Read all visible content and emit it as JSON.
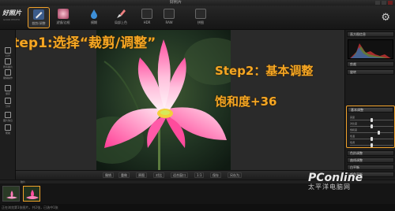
{
  "window": {
    "title": "好照片"
  },
  "toolbar": {
    "logo": "好照片",
    "logo_sub": "GOOD PHOTO",
    "tools": [
      {
        "label": "裁剪/调整",
        "icon": "pencil-icon",
        "color": "#4a6fa5"
      },
      {
        "label": "滤镜/边框",
        "icon": "filter-icon",
        "color": "#c75f7a"
      },
      {
        "label": "模糊",
        "icon": "blur-drop-icon",
        "color": "#3d8fd8"
      },
      {
        "label": "局部上色",
        "icon": "brush-icon",
        "color": "#e0e0e0"
      },
      {
        "label": "HDR",
        "icon": "hdr-icon",
        "color": "#444"
      },
      {
        "label": "RAW",
        "icon": "raw-icon",
        "color": "#444"
      },
      {
        "label": "拼图",
        "icon": "collage-icon",
        "color": "#444"
      }
    ]
  },
  "left_panel": [
    {
      "label": "打开",
      "icon": "folder-icon"
    },
    {
      "label": "所有图片",
      "icon": "grid-icon"
    },
    {
      "label": "撤销操作",
      "icon": "undo-icon"
    },
    {
      "label": "保存",
      "icon": "save-icon"
    },
    {
      "label": "分享",
      "icon": "share-icon"
    },
    {
      "label": "图片信息",
      "icon": "info-icon"
    },
    {
      "label": "帮助",
      "icon": "help-icon"
    }
  ],
  "annotations": {
    "step1": "Step1:选择“裁剪/调整”",
    "step2": "Step2：基本调整",
    "step3": "饱和度+36"
  },
  "right_panel": {
    "histogram_title": "直方图信息",
    "sections": [
      "剪裁",
      "旋转",
      "基本调整",
      "色阶调整",
      "曲线调整",
      "白平衡",
      "颜色平衡",
      "锐化",
      "降噪",
      "去除红眼"
    ],
    "open_section": "基本调整",
    "sliders": [
      {
        "label": "亮度",
        "value": "",
        "fraction": 0.5
      },
      {
        "label": "对比度",
        "value": "",
        "fraction": 0.5
      },
      {
        "label": "饱和度",
        "value": "",
        "fraction": 0.68
      },
      {
        "label": "色温",
        "value": "",
        "fraction": 0.5
      },
      {
        "label": "色调",
        "value": "",
        "fraction": 0.5
      }
    ]
  },
  "bottom_bar": {
    "buttons": [
      "撤销",
      "重做",
      "原图",
      "对比",
      "适合窗口",
      "1:1",
      "保存",
      "另存为"
    ]
  },
  "filmstrip": {
    "label": "胶片",
    "thumbs": 2,
    "selected_index": 1
  },
  "status_bar": "正在浏览第1张图片，共2张，已选中1张",
  "watermark": {
    "brand": "PConline",
    "tagline": "太平洋电脑网"
  },
  "colors": {
    "accent": "#f0a12a",
    "annotation": "#f5a623"
  }
}
